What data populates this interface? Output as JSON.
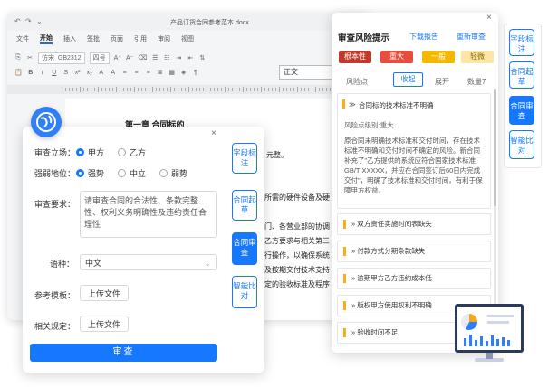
{
  "word": {
    "title": "产品订货合同参考范本.docx",
    "quick_icons": [
      "↶",
      "↷",
      "⌄"
    ],
    "menu": [
      "文件",
      "开始",
      "插入",
      "签批",
      "页面",
      "引用",
      "审阅",
      "视图"
    ],
    "font_name": "仿宋_GB2312",
    "font_size": "四号",
    "style_name": "正文",
    "chapter_title": "第一章 合同标的",
    "text_lines": [
      "元整。",
      "所需的硬件设备及硬",
      "门、各营业部的协调",
      "乙方要求与相关第三",
      "行操作，以确保系统",
      "及按期交付技术支持",
      "定的验收标准及程序"
    ]
  },
  "contract_panel": {
    "close": "×",
    "stance_label": "审查立场：",
    "stance_options": [
      "甲方",
      "乙方"
    ],
    "strength_label": "强弱地位：",
    "strength_options": [
      "强势",
      "中立",
      "弱势"
    ],
    "requirement_label": "审查要求：",
    "requirement_text": "请审查合同的合法性、条款完整性、权利义务明确性及违约责任合理性",
    "language_label": "语种：",
    "language_value": "中文",
    "template_label": "参考模板：",
    "related_label": "相关规定：",
    "upload_label": "上传文件",
    "review_button": "审查",
    "tabs": [
      "字段标注",
      "合同起草",
      "合同审查",
      "智能比对"
    ],
    "active_tab": 2
  },
  "risk_panel": {
    "close": "×",
    "title": "审查风险提示",
    "download": "下载报告",
    "rereview": "重新审查",
    "levels": [
      {
        "label": "根本性",
        "bg": "#c0392b",
        "fg": "#ffffff"
      },
      {
        "label": "重大",
        "bg": "#e74c3c",
        "fg": "#ffffff"
      },
      {
        "label": "一般",
        "bg": "#f5b800",
        "fg": "#ffffff"
      },
      {
        "label": "轻微",
        "bg": "#fbe7a3",
        "fg": "#8a6d00"
      }
    ],
    "tab_location": "风险点",
    "tab_collapse": "收起",
    "tab_expand": "展开",
    "count": "数量7",
    "expanded_title": "合同标的技术标准不明确",
    "risk_level": "风险点级别:重大",
    "detail": "原合同未明确技术标准和交付时间，存在技术标准不明确和交付时间不确定的风险。新合同补充了\"乙方提供的系统应符合国家技术标准GB/T XXXXX，并应在合同签订后60日内完成交付\"，明确了技术标准和交付时间，有利于保障甲方权益。",
    "items": [
      "双方责任实施时间表缺失",
      "付款方式分期条款缺失",
      "逾期甲方乙方违约成本低",
      "版权甲方使用权利不明确",
      "验收时间不足"
    ],
    "side_tabs": [
      "字段标注",
      "合同起草",
      "合同审查",
      "智能比对"
    ],
    "side_active": 2
  },
  "colors": {
    "accent": "#1677ff",
    "warning": "#faad14"
  }
}
